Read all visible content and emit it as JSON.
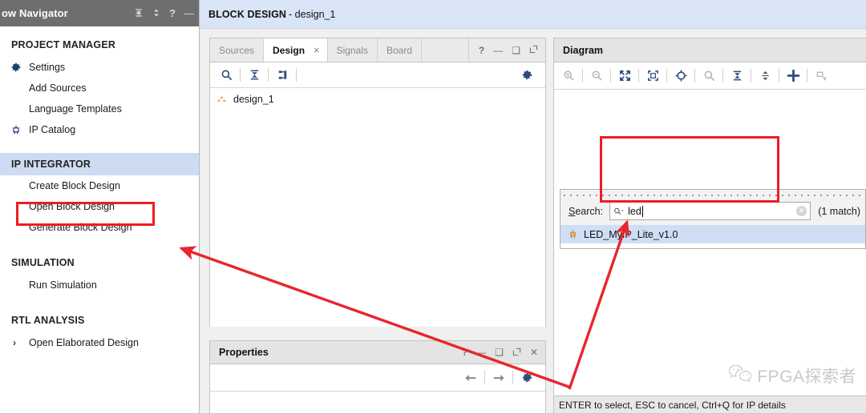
{
  "flow_navigator": {
    "title": "ow Navigator",
    "header_icons": [
      {
        "name": "collapse-all-icon",
        "glyph": "⧉"
      },
      {
        "name": "expand-collapse-icon",
        "glyph": "⇕"
      },
      {
        "name": "help-icon",
        "glyph": "?"
      },
      {
        "name": "minimize-icon",
        "glyph": "—"
      }
    ],
    "sections": [
      {
        "label": "PROJECT MANAGER",
        "highlighted": false,
        "items": [
          {
            "label": "Settings",
            "icon": "gear-icon"
          },
          {
            "label": "Add Sources",
            "icon": ""
          },
          {
            "label": "Language Templates",
            "icon": ""
          },
          {
            "label": "IP Catalog",
            "icon": "ip-catalog-icon"
          }
        ]
      },
      {
        "label": "IP INTEGRATOR",
        "highlighted": true,
        "items": [
          {
            "label": "Create Block Design",
            "icon": ""
          },
          {
            "label": "Open Block Design",
            "icon": ""
          },
          {
            "label": "Generate Block Design",
            "icon": ""
          }
        ]
      },
      {
        "label": "SIMULATION",
        "highlighted": false,
        "items": [
          {
            "label": "Run Simulation",
            "icon": ""
          }
        ]
      },
      {
        "label": "RTL ANALYSIS",
        "highlighted": false,
        "items": [
          {
            "label": "Open Elaborated Design",
            "icon": "chevron-right-icon"
          }
        ]
      }
    ]
  },
  "block_design_bar": {
    "title_strong": "BLOCK DESIGN",
    "title_rest": "- design_1"
  },
  "design_panel": {
    "tabs": [
      {
        "label": "Sources",
        "active": false,
        "closable": false
      },
      {
        "label": "Design",
        "active": true,
        "closable": true
      },
      {
        "label": "Signals",
        "active": false,
        "closable": false
      },
      {
        "label": "Board",
        "active": false,
        "closable": false
      }
    ],
    "window_buttons": [
      {
        "name": "help-icon",
        "glyph": "?"
      },
      {
        "name": "minimize-icon",
        "glyph": "—"
      },
      {
        "name": "maximize-icon",
        "glyph": "□"
      },
      {
        "name": "float-icon",
        "glyph": "↗"
      }
    ],
    "toolbar": [
      {
        "name": "search-icon"
      },
      {
        "name": "collapse-all-icon"
      },
      {
        "name": "expand-all-icon"
      },
      {
        "name": "settings-gear-icon"
      }
    ],
    "tree": [
      {
        "label": "design_1",
        "icon": "block-design-icon"
      }
    ]
  },
  "properties_panel": {
    "title": "Properties",
    "window_buttons": [
      {
        "name": "help-icon",
        "glyph": "?"
      },
      {
        "name": "minimize-icon",
        "glyph": "—"
      },
      {
        "name": "maximize-icon",
        "glyph": "□"
      },
      {
        "name": "float-icon",
        "glyph": "↗"
      },
      {
        "name": "close-icon",
        "glyph": "✕"
      }
    ],
    "toolbar": [
      {
        "name": "back-arrow-icon"
      },
      {
        "name": "forward-arrow-icon"
      },
      {
        "name": "settings-gear-icon"
      }
    ]
  },
  "diagram_panel": {
    "title": "Diagram",
    "toolbar": [
      {
        "name": "zoom-in-icon",
        "enabled": false
      },
      {
        "name": "zoom-out-icon",
        "enabled": false
      },
      {
        "name": "zoom-fit-icon",
        "enabled": true
      },
      {
        "name": "zoom-area-icon",
        "enabled": true
      },
      {
        "name": "refresh-layout-icon",
        "enabled": true
      },
      {
        "name": "search-icon",
        "enabled": false
      },
      {
        "name": "collapse-all-icon",
        "enabled": true
      },
      {
        "name": "expand-all-icon",
        "enabled": true
      },
      {
        "name": "add-ip-icon",
        "enabled": true
      },
      {
        "name": "add-module-icon",
        "enabled": false
      }
    ],
    "status_text": "ENTER to select, ESC to cancel, Ctrl+Q for IP details"
  },
  "ip_search_popup": {
    "search_label": "Search:",
    "search_label_mnemonic": "S",
    "search_label_rest": "earch:",
    "search_value": "led",
    "search_placeholder": "",
    "match_count": "(1 match)",
    "clear_icon": "clear-icon",
    "results": [
      {
        "label": "LED_MyIP_Lite_v1.0",
        "icon": "ip-core-icon",
        "selected": true
      }
    ]
  },
  "watermark": {
    "text": "FPGA探索者",
    "icon": "wechat-icon"
  },
  "annotations": {
    "highlight_color": "#ee1c23",
    "boxes": [
      {
        "name": "create-block-design-highlight",
        "target": "Create Block Design"
      },
      {
        "name": "ip-search-popup-highlight",
        "target": "IP search popup"
      }
    ],
    "arrows": [
      {
        "name": "arrow-to-create-block-design"
      },
      {
        "name": "arrow-to-ip-search-popup"
      }
    ]
  }
}
